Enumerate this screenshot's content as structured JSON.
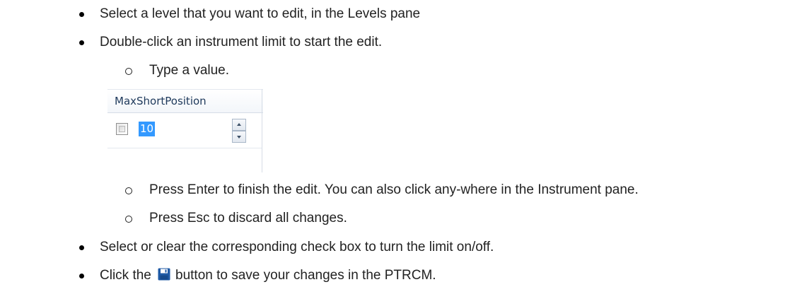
{
  "instructions": {
    "step1": "Select a level that you want to edit, in the Levels pane",
    "step2": "Double-click an instrument limit to start the edit.",
    "sub_steps": {
      "type_value": "Type a value.",
      "press_enter": "Press Enter to finish the edit. You can also click any-where in the Instrument pane.",
      "press_esc": "Press Esc to discard all changes."
    },
    "step3": "Select or clear the corresponding check box to turn the limit on/off.",
    "step4_before_icon": "Click the",
    "step4_after_icon": "button to save your changes in the PTRCM."
  },
  "grid_example": {
    "column_header": "MaxShortPosition",
    "checkbox_checked": false,
    "value": "10"
  },
  "icons": {
    "bullet": "filled-circle-bullet",
    "sub_bullet": "hollow-circle-bullet",
    "save": "floppy-disk-icon"
  },
  "colors": {
    "selection_highlight": "#3399ff",
    "save_icon": "#1f5aa6",
    "header_text": "#1e395b"
  }
}
